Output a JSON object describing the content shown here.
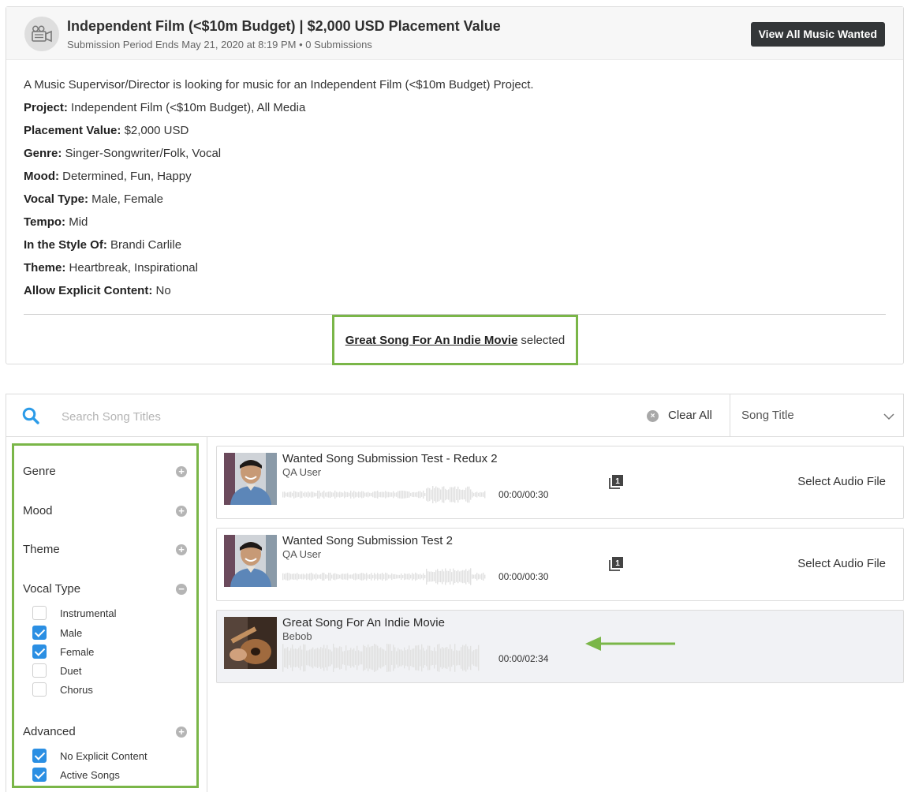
{
  "header": {
    "title": "Independent Film (<$10m Budget) | $2,000 USD Placement Value",
    "subtitle": "Submission Period Ends May 21, 2020 at 8:19 PM • 0 Submissions",
    "view_all_label": "View All Music Wanted"
  },
  "description": "A Music Supervisor/Director is looking for music for an Independent Film (<$10m Budget) Project.",
  "details": [
    {
      "label": "Project:",
      "value": "Independent Film (<$10m Budget), All Media"
    },
    {
      "label": "Placement Value:",
      "value": "$2,000 USD"
    },
    {
      "label": "Genre:",
      "value": "Singer-Songwriter/Folk, Vocal"
    },
    {
      "label": "Mood:",
      "value": "Determined, Fun, Happy"
    },
    {
      "label": "Vocal Type:",
      "value": "Male, Female"
    },
    {
      "label": "Tempo:",
      "value": "Mid"
    },
    {
      "label": "In the Style Of:",
      "value": "Brandi Carlile"
    },
    {
      "label": "Theme:",
      "value": "Heartbreak, Inspirational"
    },
    {
      "label": "Allow Explicit Content:",
      "value": "No"
    }
  ],
  "selected": {
    "song": "Great Song For An Indie Movie",
    "suffix": "selected"
  },
  "search": {
    "placeholder": "Search Song Titles",
    "clear_all": "Clear All",
    "sort_value": "Song Title"
  },
  "filters": {
    "genre": "Genre",
    "mood": "Mood",
    "theme": "Theme",
    "vocal_type": "Vocal Type",
    "vocal_options": [
      {
        "label": "Instrumental",
        "checked": false
      },
      {
        "label": "Male",
        "checked": true
      },
      {
        "label": "Female",
        "checked": true
      },
      {
        "label": "Duet",
        "checked": false
      },
      {
        "label": "Chorus",
        "checked": false
      }
    ],
    "advanced": "Advanced",
    "advanced_options": [
      {
        "label": "No Explicit Content",
        "checked": true
      },
      {
        "label": "Active Songs",
        "checked": true
      }
    ],
    "expand_symbol": "+",
    "collapse_symbol": "−"
  },
  "songs": [
    {
      "title": "Wanted Song Submission Test - Redux 2",
      "artist": "QA User",
      "time": "00:00/00:30",
      "action": "Select Audio File",
      "copy_count": "1"
    },
    {
      "title": "Wanted Song Submission Test 2",
      "artist": "QA User",
      "time": "00:00/00:30",
      "action": "Select Audio File",
      "copy_count": "1"
    },
    {
      "title": "Great Song For An Indie Movie",
      "artist": "Bebob",
      "time": "00:00/02:34"
    }
  ],
  "colors": {
    "highlight_green": "#7ab648",
    "checkbox_blue": "#2b8fe3",
    "search_icon_blue": "#2b9be8"
  }
}
